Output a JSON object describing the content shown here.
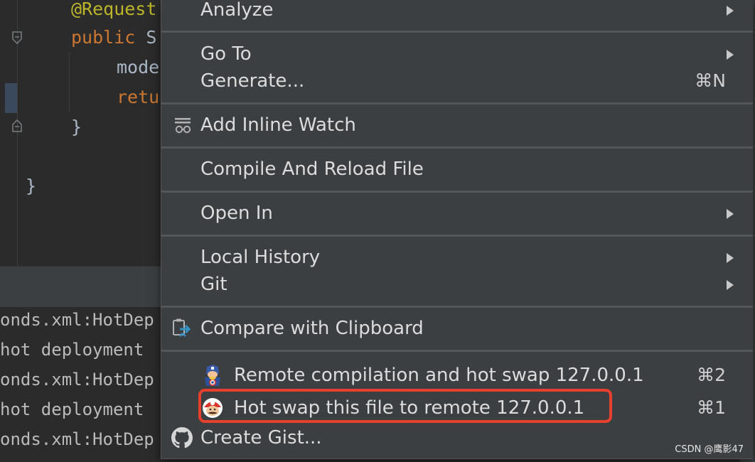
{
  "editor": {
    "line1": {
      "annotation": "@Request"
    },
    "line2": {
      "keyword": "public",
      "rest": " S"
    },
    "line3": {
      "text": "mode"
    },
    "line4": {
      "keyword": "retu"
    },
    "line5": {
      "text": "}"
    },
    "line6": {
      "text": "}"
    }
  },
  "console": {
    "lines": [
      "onds.xml:HotDep",
      "hot deployment ",
      "onds.xml:HotDep",
      "hot deployment ",
      "onds.xml:HotDep"
    ]
  },
  "menu": {
    "items": [
      {
        "label": "Analyze",
        "submenu": true
      },
      {
        "label": "Go To",
        "submenu": true
      },
      {
        "label": "Generate...",
        "shortcut": "⌘N"
      },
      {
        "label": "Add Inline Watch",
        "icon": "inline-watch-icon"
      },
      {
        "label": "Compile And Reload File"
      },
      {
        "label": "Open In",
        "submenu": true
      },
      {
        "label": "Local History",
        "submenu": true
      },
      {
        "label": "Git",
        "submenu": true
      },
      {
        "label": "Compare with Clipboard",
        "icon": "compare-clipboard-icon"
      },
      {
        "label": "Remote compilation and hot swap 127.0.0.1",
        "shortcut": "⌘2",
        "icon": "captain-america-icon"
      },
      {
        "label": "Hot swap this file to remote 127.0.0.1",
        "shortcut": "⌘1",
        "icon": "mario-icon",
        "highlighted": true
      },
      {
        "label": "Create Gist...",
        "icon": "github-icon"
      }
    ]
  },
  "watermark": "CSDN @鹰影47",
  "colors": {
    "menu_bg": "#3c3f41",
    "highlight": "#e8402f",
    "annotation": "#bbb529",
    "keyword": "#cc7832"
  }
}
